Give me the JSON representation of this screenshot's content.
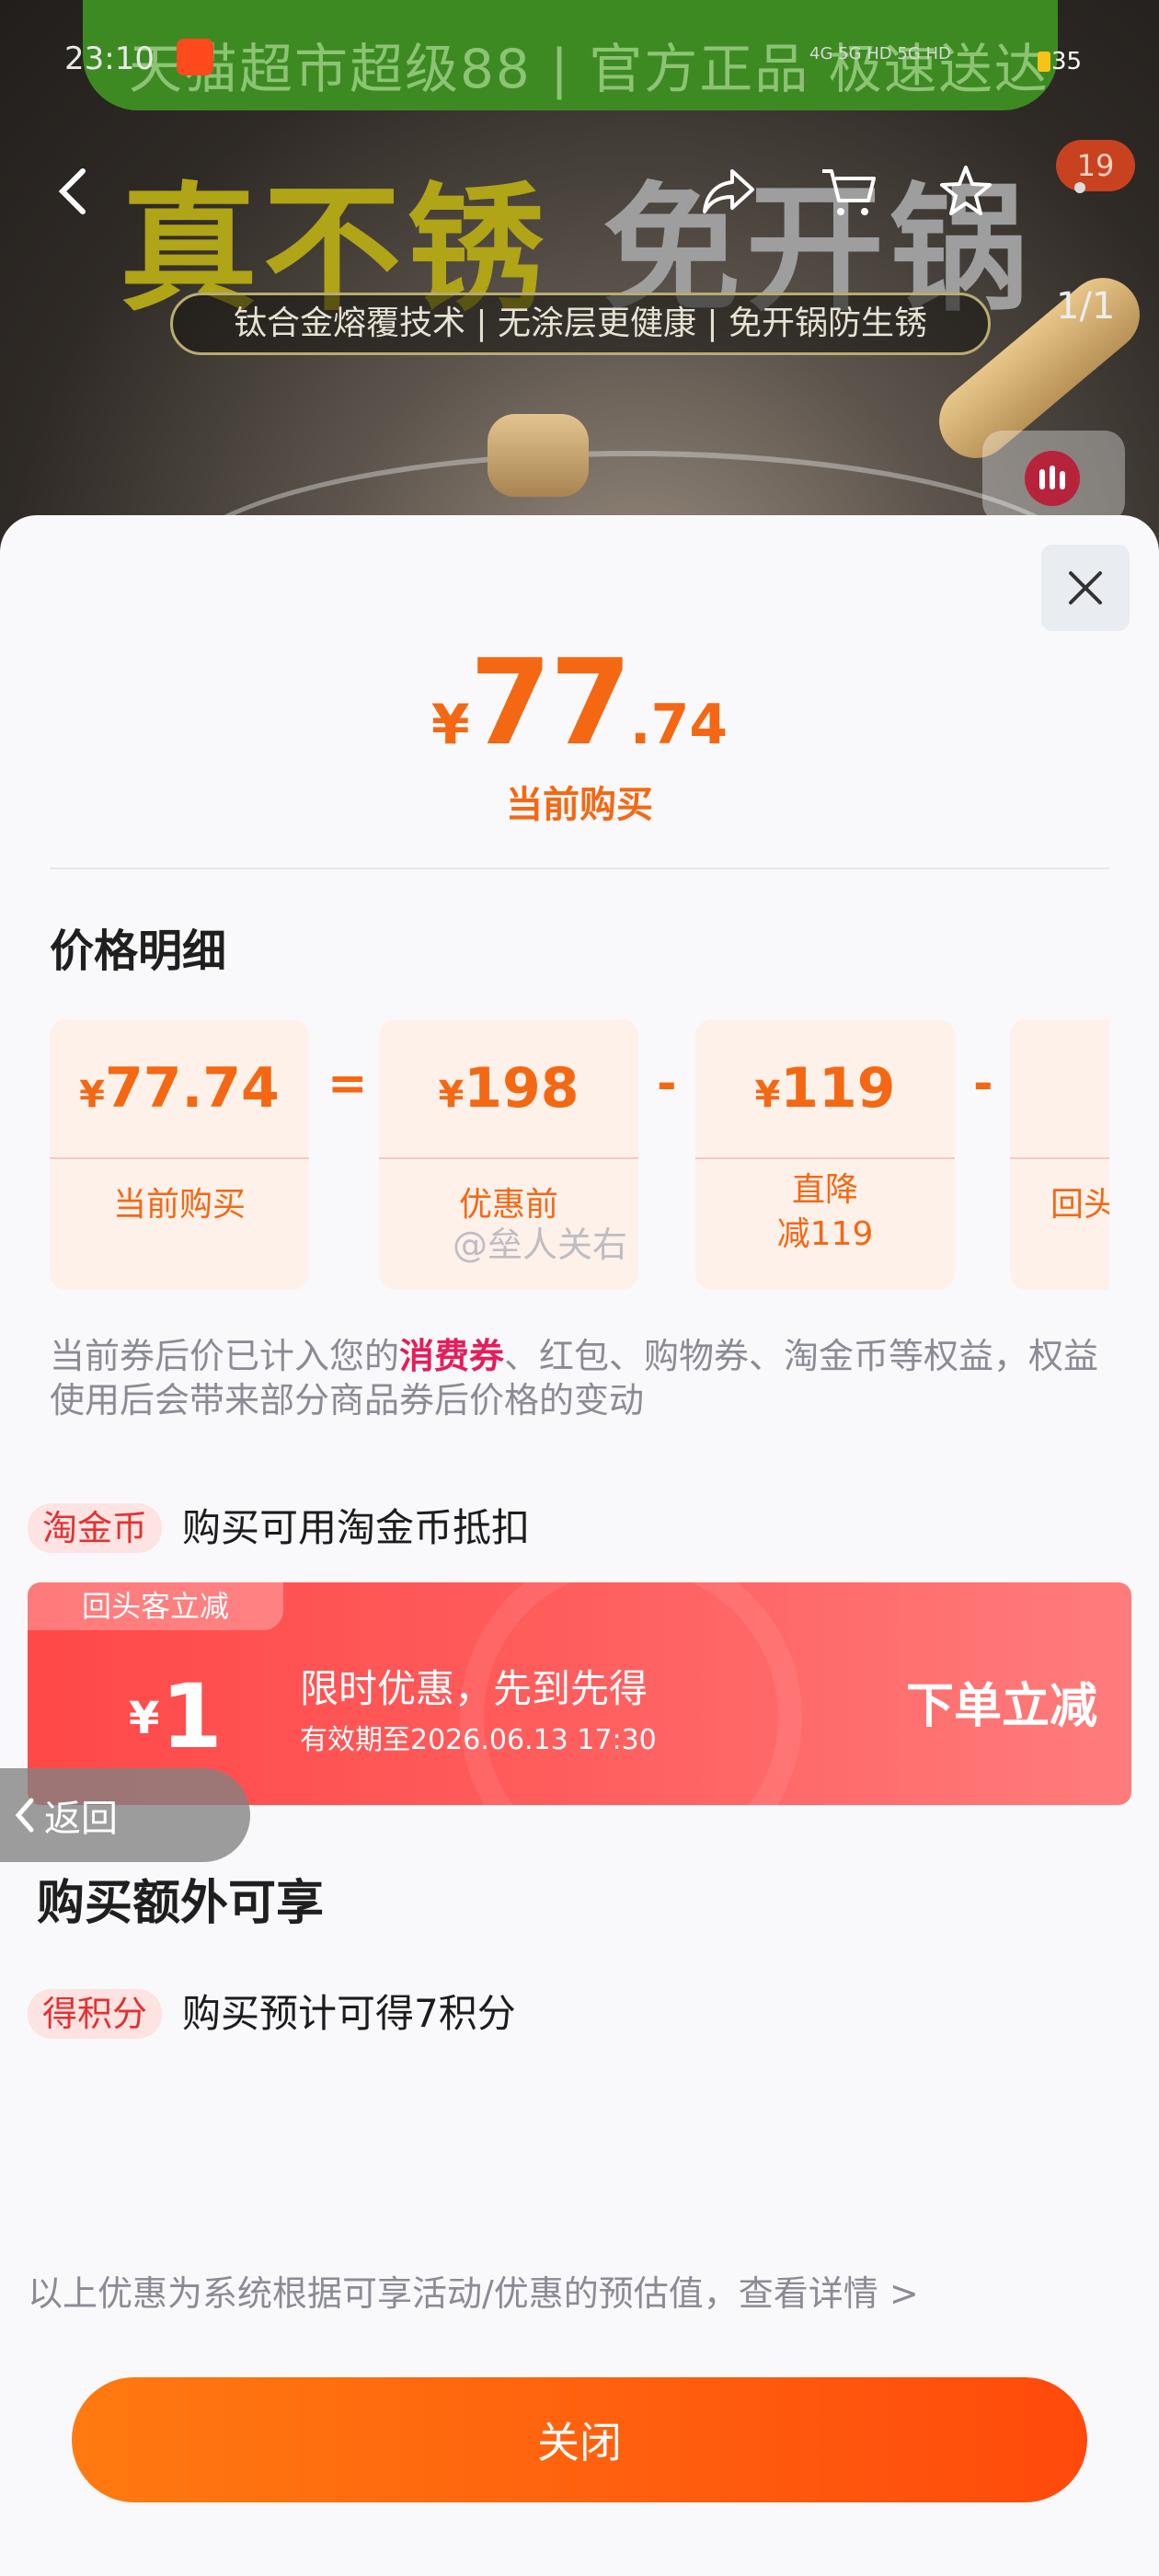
{
  "status_bar": {
    "time": "23:10",
    "network": "4G 5G HD 5G HD",
    "battery": "35"
  },
  "banner": {
    "promo": "天猫超市超级88 | 官方正品 极速送达",
    "headline_left": "真不锈",
    "headline_right": "免开锅",
    "subline": "钛合金熔覆技术 | 无涂层更健康 | 免开锅防生锈",
    "cart_badge": "19",
    "image_counter": "1/1"
  },
  "sheet": {
    "price": {
      "symbol": "¥",
      "integer": "77",
      "decimal": ".74"
    },
    "current_label": "当前购买",
    "detail_title": "价格明细",
    "breakdown": [
      {
        "symbol": "¥",
        "amount": "77.74",
        "label": "当前购买"
      },
      {
        "symbol": "¥",
        "amount": "198",
        "label": "优惠前"
      },
      {
        "symbol": "¥",
        "amount": "119",
        "label": "直降\n减119"
      },
      {
        "symbol": "",
        "amount": "",
        "label": "回头"
      }
    ],
    "operators": [
      "=",
      "-",
      "-"
    ],
    "watermark": "@垒人关右",
    "note": {
      "before": "当前券后价已计入您的",
      "highlight": "消费券",
      "after": "、红包、购物券、淘金币等权益，权益使用后会带来部分商品券后价格的变动"
    },
    "coin": {
      "tag": "淘金币",
      "text": "购买可用淘金币抵扣"
    },
    "coupon": {
      "tab": "回头客立减",
      "symbol": "¥",
      "amount": "1",
      "title": "限时优惠，先到先得",
      "validity": "有效期至2026.06.13 17:30",
      "cta": "下单立减"
    },
    "float_back": "返回",
    "extra_title": "购买额外可享",
    "points": {
      "tag": "得积分",
      "text": "购买预计可得7积分"
    },
    "disclaimer": "以上优惠为系统根据可享活动/优惠的预估值，查看详情 >",
    "close_button": "关闭"
  },
  "colors": {
    "accent": "#f46814",
    "coupon_red": "#ff4848",
    "highlight": "#e31e5a",
    "button_start": "#ff7a10",
    "button_end": "#ff4a0c"
  },
  "icons": [
    "back-arrow-icon",
    "share-icon",
    "cart-icon",
    "star-icon",
    "more-icon",
    "video-icon",
    "close-icon",
    "chevron-left-icon"
  ]
}
